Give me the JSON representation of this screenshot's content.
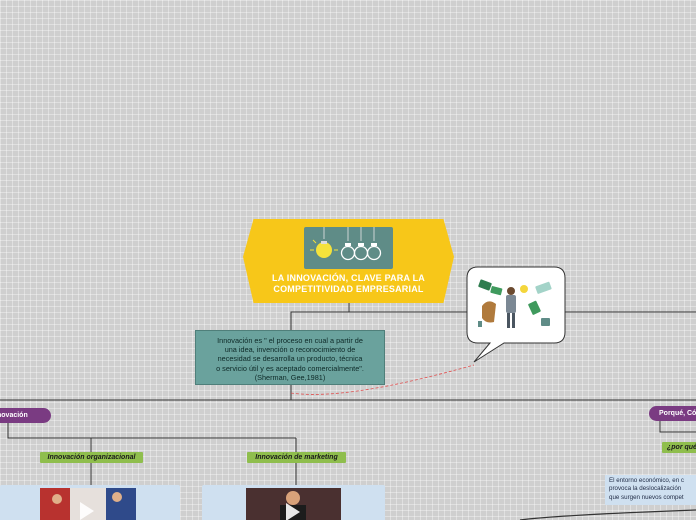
{
  "central_topic": {
    "title_line1": "LA INNOVACIÓN, CLAVE PARA LA",
    "title_line2": "COMPETITIVIDAD EMPRESARIAL",
    "image_icon": "lightbulbs-icon"
  },
  "definition": {
    "line1": "Innovación es \" el proceso en cual a partir de",
    "line2": "una idea, invención o reconocimiento de",
    "line3": "necesidad se desarrolla un producto, técnica",
    "line4": "o servicio útil y es aceptado comercialmente\".",
    "line5": "(Sherman, Gee,1981)"
  },
  "callout": {
    "image_icon": "businessman-money-icon"
  },
  "branches": {
    "left_pill": "novación",
    "right_pill": "Porqué, Có"
  },
  "subtopics": {
    "organizational": "Innovación organizacional",
    "marketing": "Innovación de marketing",
    "question": "¿por qué"
  },
  "right_text": {
    "line1": "El entorno económico, en c",
    "line2": "provoca la deslocalización",
    "line3": "que surgen nuevos compet"
  },
  "colors": {
    "central": "#f7c719",
    "definition": "#6aa29d",
    "pill": "#7a3b82",
    "subtopic": "#8fbe4d",
    "panel": "#cfe0f0"
  }
}
